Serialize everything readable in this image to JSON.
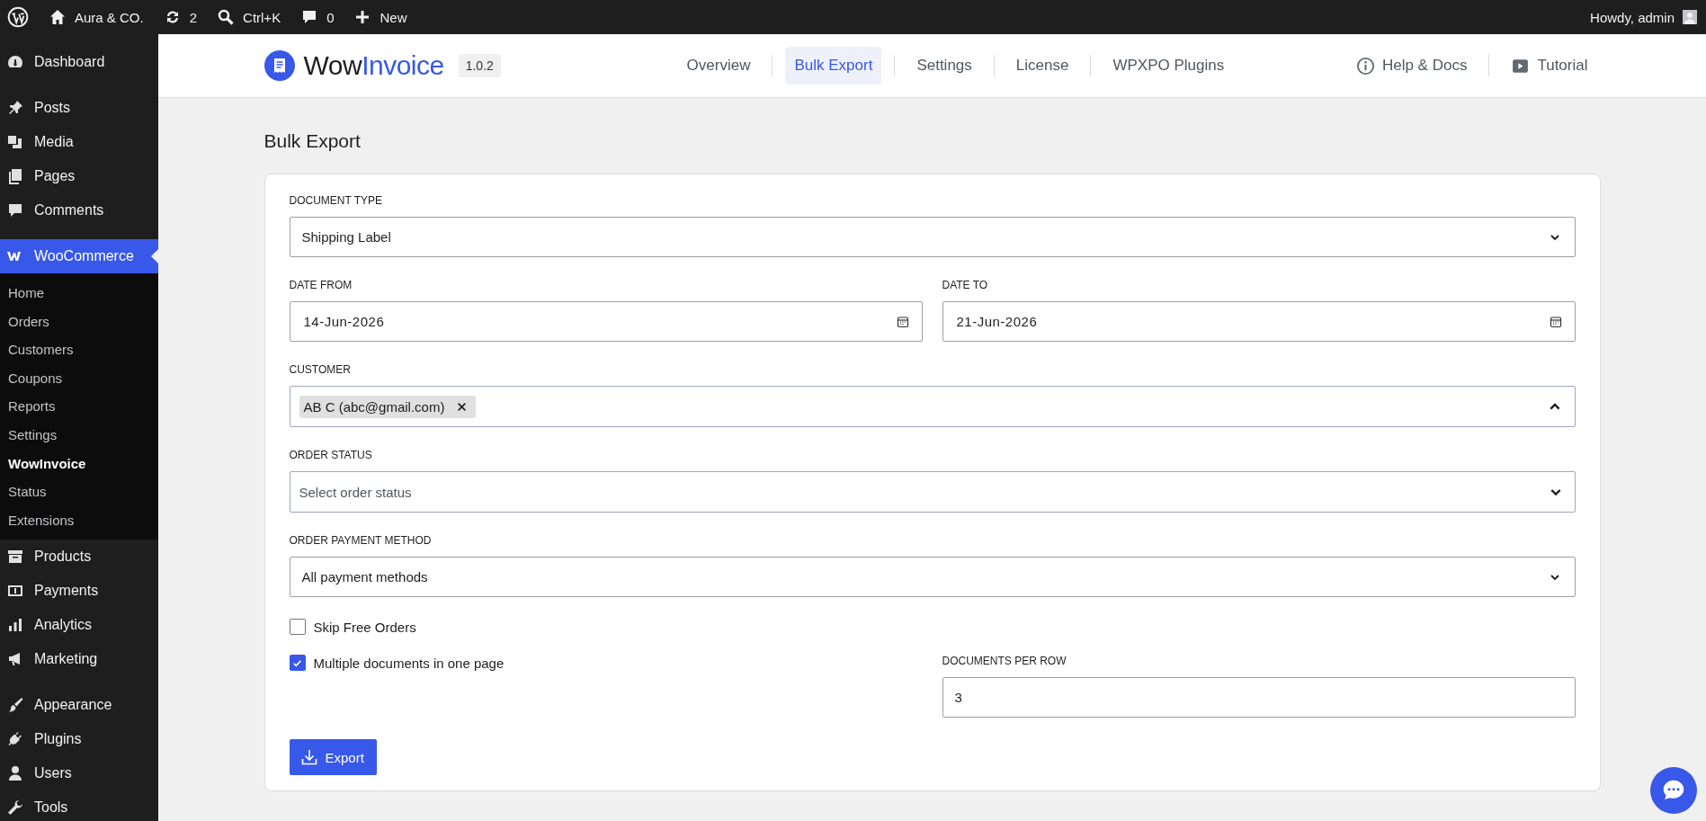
{
  "admin_bar": {
    "items": [
      {
        "kind": "logo"
      },
      {
        "kind": "home",
        "label": "Aura & CO."
      },
      {
        "kind": "updates",
        "label": "2"
      },
      {
        "kind": "search",
        "label": "Ctrl+K"
      },
      {
        "kind": "comments",
        "label": "0"
      },
      {
        "kind": "new",
        "label": "New"
      }
    ],
    "greeting": "Howdy, admin"
  },
  "sidebar": {
    "groups": [
      {
        "items": [
          {
            "label": "Dashboard",
            "kind": "dashboard",
            "selected": false
          }
        ]
      },
      {
        "items": [
          {
            "label": "Posts",
            "kind": "posts",
            "selected": false
          },
          {
            "label": "Media",
            "kind": "media",
            "selected": false
          },
          {
            "label": "Pages",
            "kind": "pages",
            "selected": false
          },
          {
            "label": "Comments",
            "kind": "comments",
            "selected": false
          }
        ]
      },
      {
        "items": [
          {
            "label": "WooCommerce",
            "kind": "woo",
            "selected": true,
            "children": [
              {
                "label": "Home",
                "selected": false
              },
              {
                "label": "Orders",
                "selected": false
              },
              {
                "label": "Customers",
                "selected": false
              },
              {
                "label": "Coupons",
                "selected": false
              },
              {
                "label": "Reports",
                "selected": false
              },
              {
                "label": "Settings",
                "selected": false
              },
              {
                "label": "WowInvoice",
                "selected": true
              },
              {
                "label": "Status",
                "selected": false
              },
              {
                "label": "Extensions",
                "selected": false
              }
            ]
          },
          {
            "label": "Products",
            "kind": "products",
            "selected": false
          },
          {
            "label": "Payments",
            "kind": "payments",
            "selected": false
          },
          {
            "label": "Analytics",
            "kind": "analytics",
            "selected": false
          },
          {
            "label": "Marketing",
            "kind": "marketing",
            "selected": false
          }
        ]
      },
      {
        "items": [
          {
            "label": "Appearance",
            "kind": "appearance",
            "selected": false
          },
          {
            "label": "Plugins",
            "kind": "plugins",
            "selected": false
          },
          {
            "label": "Users",
            "kind": "users",
            "selected": false
          },
          {
            "label": "Tools",
            "kind": "tools",
            "selected": false
          }
        ]
      }
    ]
  },
  "header": {
    "brand": {
      "prefix": "Wow",
      "suffix": "Invoice",
      "version": "1.0.2"
    },
    "tabs": [
      {
        "label": "Overview",
        "selected": false
      },
      {
        "label": "Bulk Export",
        "selected": true
      },
      {
        "label": "Settings",
        "selected": false
      },
      {
        "label": "License",
        "selected": false
      },
      {
        "label": "WPXPO Plugins",
        "selected": false
      }
    ],
    "links": [
      {
        "label": "Help & Docs",
        "kind": "help"
      },
      {
        "label": "Tutorial",
        "kind": "tutorial"
      }
    ]
  },
  "page_title": "Bulk Export",
  "form": {
    "document_type": {
      "label": "DOCUMENT TYPE",
      "value": "Shipping Label"
    },
    "date_from": {
      "label": "DATE FROM",
      "value": "14-Jun-2026"
    },
    "date_to": {
      "label": "DATE TO",
      "value": "21-Jun-2026"
    },
    "customer": {
      "label": "CUSTOMER",
      "tags": [
        "AB C (abc@gmail.com)"
      ],
      "expanded": true
    },
    "order_status": {
      "label": "ORDER STATUS",
      "placeholder": "Select order status",
      "expanded": false
    },
    "payment_method": {
      "label": "ORDER PAYMENT METHOD",
      "value": "All payment methods"
    },
    "skip_free": {
      "label": "Skip Free Orders",
      "checked": false
    },
    "multiple": {
      "label": "Multiple documents in one page",
      "checked": true
    },
    "docs_per_row": {
      "label": "DOCUMENTS PER ROW",
      "value": "3"
    },
    "export_button": "Export"
  }
}
